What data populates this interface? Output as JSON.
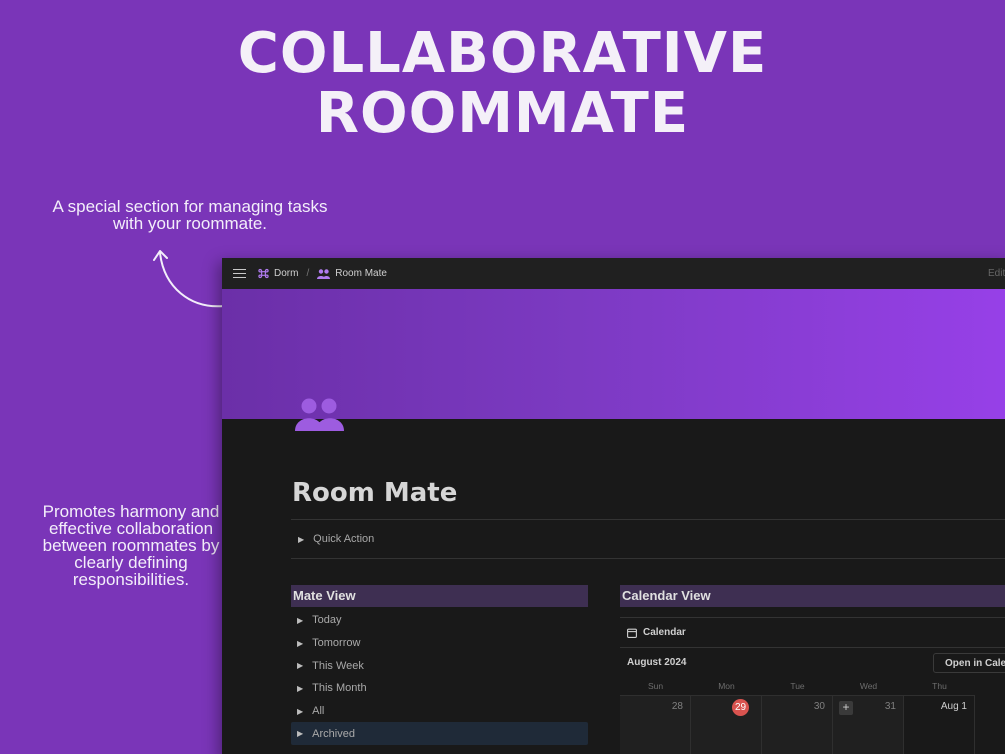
{
  "headline": {
    "line1": "COLLABORATIVE",
    "line2": "ROOMMATE"
  },
  "callouts": {
    "top": "A special section for managing tasks with your roommate.",
    "bottom": "Promotes harmony and effective collaboration between roommates by clearly defining responsibilities."
  },
  "topbar": {
    "breadcrumb": [
      {
        "label": "Dorm",
        "icon": "command-icon"
      },
      {
        "label": "Room Mate",
        "icon": "people-icon"
      }
    ],
    "separator": "/",
    "edited": "Edited"
  },
  "page": {
    "title": "Room Mate",
    "quick_action": "Quick Action"
  },
  "mate_view": {
    "heading": "Mate View",
    "items": [
      "Today",
      "Tomorrow",
      "This Week",
      "This Month",
      "All",
      "Archived"
    ],
    "active_item": "Archived"
  },
  "calendar_view": {
    "heading": "Calendar View",
    "tab_label": "Calendar",
    "month": "August 2024",
    "open_button": "Open in Calendar",
    "weekdays": [
      "Sun",
      "Mon",
      "Tue",
      "Wed",
      "Thu"
    ],
    "days": [
      "28",
      "29",
      "30",
      "31",
      "Aug 1"
    ],
    "today": "29",
    "add_symbol": "+"
  },
  "colors": {
    "background": "#7a35b8",
    "app_background": "#191919",
    "section_header": "#3e2f52",
    "today_badge": "#d9534f",
    "calendar_icon": "#e0524f",
    "accent_purple": "#9d5ce0"
  }
}
